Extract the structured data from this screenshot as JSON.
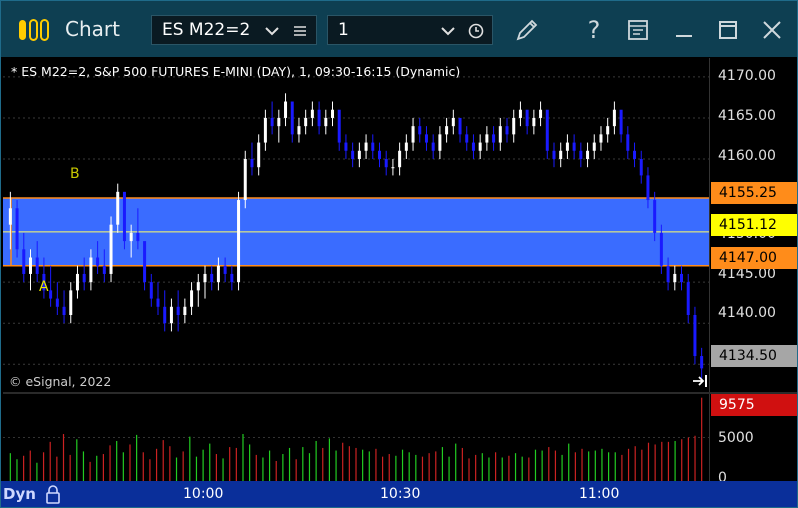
{
  "window": {
    "title": "Chart",
    "symbol_value": "ES M22=2",
    "interval_value": "1"
  },
  "chart": {
    "header": "* ES M22=2, S&P 500 FUTURES E-MINI (DAY), 1, 09:30-16:15 (Dynamic)",
    "copyright": "© eSignal, 2022",
    "annotations": [
      {
        "text": "A",
        "color": "#e8e800"
      },
      {
        "text": "B",
        "color": "#c8c800"
      }
    ],
    "price_ticks": [
      "4170.00",
      "4165.00",
      "4160.00",
      "4145.00",
      "4140.00"
    ],
    "price_tag_partial": "4150.00",
    "price_tags": [
      {
        "label": "4155.25",
        "bg": "#ff8c1a",
        "fg": "#000000"
      },
      {
        "label": "4151.12",
        "bg": "#ffff00",
        "fg": "#000000"
      },
      {
        "label": "4147.00",
        "bg": "#ff8c1a",
        "fg": "#000000"
      },
      {
        "label": "4134.50",
        "bg": "#a6a6a6",
        "fg": "#000000"
      }
    ],
    "volume_ticks": [
      "5000",
      "0"
    ],
    "volume_tag": {
      "label": "9575",
      "bg": "#d01010",
      "fg": "#ffffff"
    },
    "time_labels": [
      "10:00",
      "10:30",
      "11:00"
    ],
    "status_label": "Dyn",
    "colors": {
      "band": "#3a6cff",
      "band_line": "#ff8c1a",
      "mid_line": "#ffff66",
      "up": "#ffffff",
      "down": "#1a1aff",
      "vol_up": "#22cc22",
      "vol_down": "#cc2222",
      "titlebar": "#0e3f52",
      "timebar": "#0a2f9a"
    }
  },
  "chart_data": {
    "type": "candlestick",
    "ylim": [
      4131.5,
      4172.3
    ],
    "band": {
      "upper": 4155.25,
      "mid": 4151.12,
      "lower": 4147.0
    },
    "last_price": 4134.5,
    "volume_last": 9575,
    "volume_max": 10000,
    "bars": [
      [
        4152,
        4156,
        4149,
        4154
      ],
      [
        4154,
        4155,
        4148,
        4149
      ],
      [
        4149,
        4151,
        4145,
        4146
      ],
      [
        4146,
        4149,
        4144,
        4148
      ],
      [
        4148,
        4150,
        4145,
        4146
      ],
      [
        4146,
        4148,
        4143,
        4144
      ],
      [
        4144,
        4147,
        4142,
        4143
      ],
      [
        4143,
        4145,
        4141,
        4142
      ],
      [
        4142,
        4144,
        4140,
        4141
      ],
      [
        4141,
        4145,
        4140,
        4144
      ],
      [
        4144,
        4147,
        4143,
        4146
      ],
      [
        4146,
        4148,
        4144,
        4145
      ],
      [
        4145,
        4149,
        4144,
        4148
      ],
      [
        4148,
        4150,
        4146,
        4147
      ],
      [
        4147,
        4149,
        4145,
        4146
      ],
      [
        4146,
        4153,
        4145,
        4152
      ],
      [
        4152,
        4157,
        4151,
        4156
      ],
      [
        4156,
        4155,
        4149,
        4150
      ],
      [
        4150,
        4152,
        4148,
        4151
      ],
      [
        4151,
        4154,
        4149,
        4150
      ],
      [
        4150,
        4148,
        4144,
        4145
      ],
      [
        4145,
        4146,
        4142,
        4143
      ],
      [
        4143,
        4145,
        4141,
        4142
      ],
      [
        4142,
        4144,
        4139,
        4140
      ],
      [
        4140,
        4143,
        4139,
        4142
      ],
      [
        4142,
        4144,
        4139,
        4141
      ],
      [
        4141,
        4143,
        4140,
        4142
      ],
      [
        4142,
        4145,
        4141,
        4144
      ],
      [
        4144,
        4146,
        4142,
        4145
      ],
      [
        4145,
        4147,
        4143,
        4146
      ],
      [
        4146,
        4147,
        4144,
        4145
      ],
      [
        4145,
        4148,
        4144,
        4147
      ],
      [
        4147,
        4148,
        4145,
        4146
      ],
      [
        4146,
        4147,
        4144,
        4145
      ],
      [
        4145,
        4156,
        4144,
        4155
      ],
      [
        4155,
        4161,
        4154,
        4160
      ],
      [
        4160,
        4162,
        4158,
        4159
      ],
      [
        4159,
        4163,
        4158,
        4162
      ],
      [
        4162,
        4166,
        4161,
        4165
      ],
      [
        4165,
        4167,
        4163,
        4164
      ],
      [
        4164,
        4166,
        4162,
        4165
      ],
      [
        4165,
        4168,
        4164,
        4167
      ],
      [
        4167,
        4166,
        4162,
        4163
      ],
      [
        4163,
        4165,
        4162,
        4164
      ],
      [
        4164,
        4166,
        4163,
        4165
      ],
      [
        4165,
        4167,
        4164,
        4166
      ],
      [
        4166,
        4167,
        4163,
        4164
      ],
      [
        4164,
        4166,
        4163,
        4165
      ],
      [
        4165,
        4167,
        4164,
        4166
      ],
      [
        4166,
        4165,
        4161,
        4162
      ],
      [
        4162,
        4163,
        4160,
        4161
      ],
      [
        4161,
        4162,
        4159,
        4160
      ],
      [
        4160,
        4162,
        4159,
        4161
      ],
      [
        4161,
        4163,
        4160,
        4162
      ],
      [
        4162,
        4163,
        4160,
        4161
      ],
      [
        4161,
        4162,
        4159,
        4160
      ],
      [
        4160,
        4161,
        4158,
        4159
      ],
      [
        4159,
        4160,
        4158,
        4159
      ],
      [
        4159,
        4162,
        4158,
        4161
      ],
      [
        4161,
        4163,
        4160,
        4162
      ],
      [
        4162,
        4165,
        4161,
        4164
      ],
      [
        4164,
        4165,
        4162,
        4163
      ],
      [
        4163,
        4164,
        4161,
        4162
      ],
      [
        4162,
        4163,
        4160,
        4161
      ],
      [
        4161,
        4164,
        4160,
        4163
      ],
      [
        4163,
        4165,
        4162,
        4164
      ],
      [
        4164,
        4166,
        4163,
        4165
      ],
      [
        4165,
        4164,
        4162,
        4163
      ],
      [
        4163,
        4164,
        4161,
        4162
      ],
      [
        4162,
        4163,
        4160,
        4161
      ],
      [
        4161,
        4163,
        4160,
        4162
      ],
      [
        4162,
        4164,
        4161,
        4163
      ],
      [
        4163,
        4164,
        4161,
        4162
      ],
      [
        4162,
        4165,
        4161,
        4164
      ],
      [
        4164,
        4165,
        4162,
        4163
      ],
      [
        4163,
        4166,
        4162,
        4165
      ],
      [
        4165,
        4167,
        4164,
        4166
      ],
      [
        4166,
        4165,
        4163,
        4164
      ],
      [
        4164,
        4166,
        4163,
        4165
      ],
      [
        4165,
        4167,
        4164,
        4166
      ],
      [
        4166,
        4164,
        4160,
        4161
      ],
      [
        4161,
        4162,
        4159,
        4160
      ],
      [
        4160,
        4162,
        4159,
        4161
      ],
      [
        4161,
        4163,
        4160,
        4162
      ],
      [
        4162,
        4163,
        4160,
        4161
      ],
      [
        4161,
        4162,
        4159,
        4160
      ],
      [
        4160,
        4162,
        4159,
        4161
      ],
      [
        4161,
        4163,
        4160,
        4162
      ],
      [
        4162,
        4164,
        4161,
        4163
      ],
      [
        4163,
        4165,
        4162,
        4164
      ],
      [
        4164,
        4167,
        4163,
        4166
      ],
      [
        4166,
        4165,
        4162,
        4163
      ],
      [
        4163,
        4164,
        4160,
        4161
      ],
      [
        4161,
        4162,
        4159,
        4160
      ],
      [
        4160,
        4161,
        4157,
        4158
      ],
      [
        4158,
        4159,
        4154,
        4155
      ],
      [
        4155,
        4156,
        4150,
        4151
      ],
      [
        4151,
        4152,
        4146,
        4147
      ],
      [
        4147,
        4148,
        4144,
        4145
      ],
      [
        4145,
        4147,
        4144,
        4146
      ],
      [
        4146,
        4147,
        4144,
        4145
      ],
      [
        4145,
        4146,
        4140,
        4141
      ],
      [
        4141,
        4142,
        4135,
        4136
      ],
      [
        4136,
        4137,
        4133,
        4134.5
      ]
    ],
    "volumes": [
      3200,
      2500,
      2900,
      3500,
      2100,
      3300,
      4500,
      2800,
      5400,
      3000,
      4800,
      3400,
      2200,
      2900,
      3100,
      4100,
      4600,
      3300,
      4200,
      5300,
      3300,
      2500,
      3700,
      4700,
      4000,
      2700,
      3400,
      5100,
      2800,
      3600,
      4300,
      3100,
      2600,
      3900,
      3800,
      5400,
      4200,
      3000,
      2700,
      3500,
      2300,
      3100,
      3800,
      2500,
      3900,
      3200,
      4600,
      3800,
      4900,
      3500,
      4400,
      4000,
      3800,
      3600,
      3400,
      3700,
      2800,
      3100,
      2900,
      3600,
      3300,
      3000,
      2800,
      3200,
      3400,
      3900,
      2800,
      4300,
      3800,
      2600,
      3000,
      3200,
      2700,
      3300,
      2700,
      2900,
      3200,
      2800,
      2700,
      3600,
      3500,
      3900,
      3500,
      3000,
      4300,
      3300,
      3700,
      3400,
      3500,
      3700,
      3300,
      3300,
      3000,
      3700,
      4000,
      3600,
      4400,
      4200,
      4500,
      4500,
      4600,
      4800,
      5000,
      5200,
      9575
    ]
  }
}
